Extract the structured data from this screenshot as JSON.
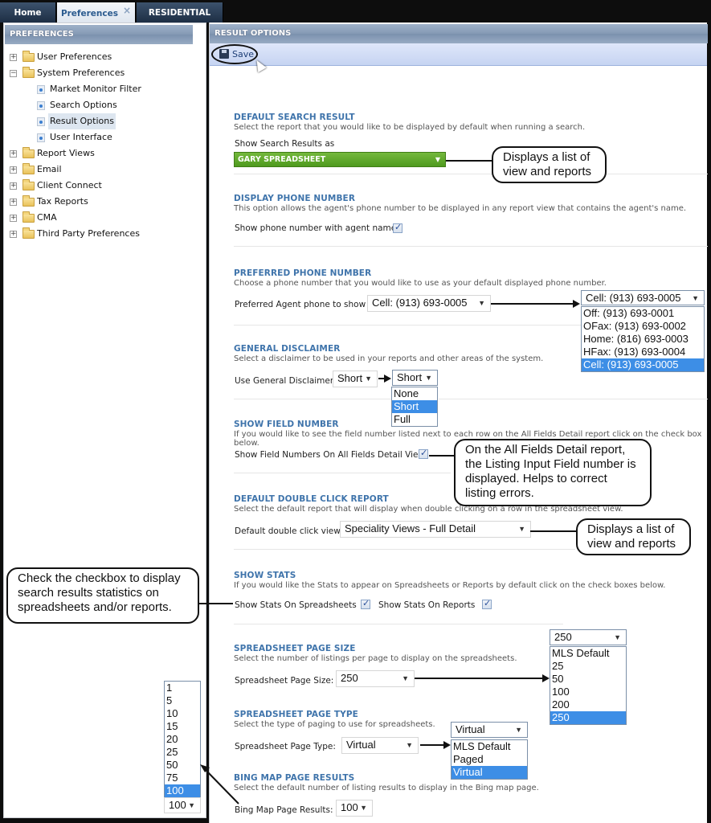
{
  "tabs": [
    {
      "label": "Home",
      "active": false
    },
    {
      "label": "Preferences",
      "active": true,
      "close_icon": "×"
    },
    {
      "label": "RESIDENTIAL",
      "active": false
    }
  ],
  "sidebar": {
    "title": "PREFERENCES",
    "items": [
      {
        "label": "User Preferences",
        "type": "folder",
        "expander": "+"
      },
      {
        "label": "System Preferences",
        "type": "folder",
        "expander": "−"
      },
      {
        "label": "Market Monitor Filter",
        "type": "page"
      },
      {
        "label": "Search Options",
        "type": "page"
      },
      {
        "label": "Result Options",
        "type": "page",
        "selected": true
      },
      {
        "label": "User Interface",
        "type": "page"
      },
      {
        "label": "Report Views",
        "type": "folder",
        "expander": "+"
      },
      {
        "label": "Email",
        "type": "folder",
        "expander": "+"
      },
      {
        "label": "Client Connect",
        "type": "folder",
        "expander": "+"
      },
      {
        "label": "Tax Reports",
        "type": "folder",
        "expander": "+"
      },
      {
        "label": "CMA",
        "type": "folder",
        "expander": "+"
      },
      {
        "label": "Third Party Preferences",
        "type": "folder",
        "expander": "+"
      }
    ]
  },
  "main": {
    "title": "RESULT OPTIONS",
    "save_label": "Save",
    "sections": {
      "default_search": {
        "title": "DEFAULT SEARCH RESULT",
        "desc": "Select the report that you would like to be displayed by default when running a search.",
        "label": "Show Search Results as",
        "value": "GARY SPREADSHEET"
      },
      "display_phone": {
        "title": "DISPLAY PHONE NUMBER",
        "desc": "This option allows the agent's phone number to be displayed in any report view that contains the agent's name.",
        "label": "Show phone number with agent name",
        "checked": true
      },
      "preferred_phone": {
        "title": "PREFERRED PHONE NUMBER",
        "desc": "Choose a phone number that you would like to use as your default displayed phone number.",
        "label": "Preferred Agent phone to show",
        "value": "Cell: (913) 693-0005",
        "options": [
          "Off: (913) 693-0001",
          "OFax: (913) 693-0002",
          "Home: (816) 693-0003",
          "HFax: (913) 693-0004",
          "Cell: (913) 693-0005"
        ]
      },
      "disclaimer": {
        "title": "GENERAL DISCLAIMER",
        "desc": "Select a disclaimer to be used in your reports and other areas of the system.",
        "label": "Use General Disclaimer",
        "value": "Short",
        "options": [
          "None",
          "Short",
          "Full"
        ]
      },
      "field_number": {
        "title": "SHOW FIELD NUMBER",
        "desc": "If you would like to see the field number listed next to each row on the All Fields Detail report click on the check box below.",
        "label": "Show Field Numbers On All Fields Detail View",
        "checked": true
      },
      "double_click": {
        "title": "DEFAULT DOUBLE CLICK REPORT",
        "desc": "Select the default report that will display when double clicking on a row in the spreadsheet view.",
        "label": "Default double click view",
        "value": "Speciality Views - Full Detail"
      },
      "stats": {
        "title": "SHOW STATS",
        "desc": "If you would like the Stats to appear on Spreadsheets or Reports by default click on the check boxes below.",
        "label_spreadsheets": "Show Stats On Spreadsheets",
        "label_reports": "Show Stats On Reports",
        "spreadsheets_checked": true,
        "reports_checked": true
      },
      "page_size": {
        "title": "SPREADSHEET PAGE SIZE",
        "desc": "Select the number of listings per page to display on the spreadsheets.",
        "label": "Spreadsheet Page Size:",
        "value": "250",
        "options": [
          "MLS Default",
          "25",
          "50",
          "100",
          "200",
          "250"
        ]
      },
      "page_type": {
        "title": "SPREADSHEET PAGE TYPE",
        "desc": "Select the type of paging to use for spreadsheets.",
        "label": "Spreadsheet Page Type:",
        "value": "Virtual",
        "options": [
          "MLS Default",
          "Paged",
          "Virtual"
        ]
      },
      "bing": {
        "title": "BING MAP PAGE RESULTS",
        "desc": "Select the default number of listing results to display in the Bing map page.",
        "label": "Bing Map Page Results:",
        "value": "100",
        "options": [
          "1",
          "5",
          "10",
          "15",
          "20",
          "25",
          "50",
          "75",
          "100"
        ]
      }
    }
  },
  "callouts": {
    "search_results": "Displays a list of view and reports",
    "field_numbers": "On the All Fields Detail report, the Listing Input Field number is displayed.  Helps to correct listing errors.",
    "double_click": "Displays a list of view and reports",
    "stats": "Check the checkbox to display search results statistics on spreadsheets and/or reports."
  },
  "icons": {
    "dropdown_arrow": "▼",
    "save": "floppy-disk-icon"
  }
}
